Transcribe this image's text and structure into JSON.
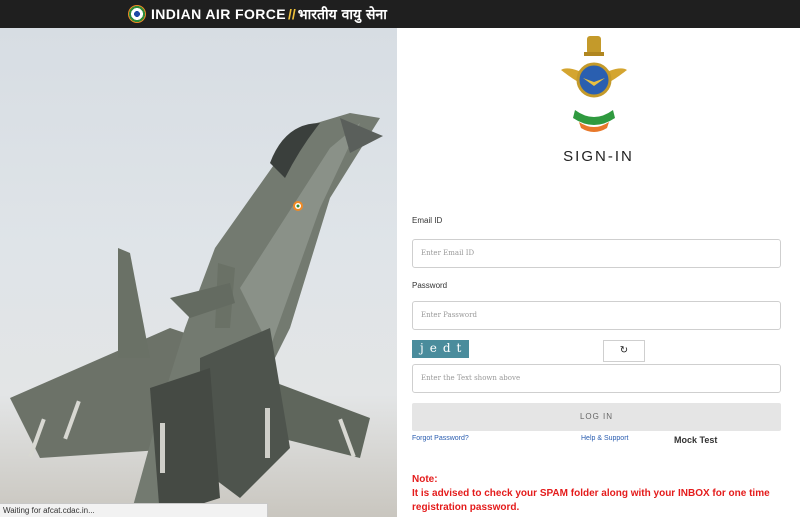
{
  "header": {
    "brand_en": "INDIAN AIR FORCE",
    "brand_sep": "//",
    "brand_hi": "भारतीय वायु सेना"
  },
  "photo": {
    "status_text": "Waiting for afcat.cdac.in..."
  },
  "signin": {
    "title": "SIGN-IN",
    "email_label": "Email ID",
    "email_placeholder": "Enter Email ID",
    "password_label": "Password",
    "password_placeholder": "Enter Password",
    "captcha_text": "jedt",
    "refresh_symbol": "↻",
    "captcha_placeholder": "Enter the Text shown above",
    "login_label": "LOG IN",
    "forgot_link": "Forgot Password?",
    "help_link": "Help & Support",
    "mock_test": "Mock Test"
  },
  "note": {
    "title": "Note:",
    "text": "It is advised to check your SPAM folder along with your INBOX for one time registration password."
  },
  "colors": {
    "topbar": "#1f1f1f",
    "note_red": "#e41b1b",
    "link_blue": "#2a5db0"
  }
}
